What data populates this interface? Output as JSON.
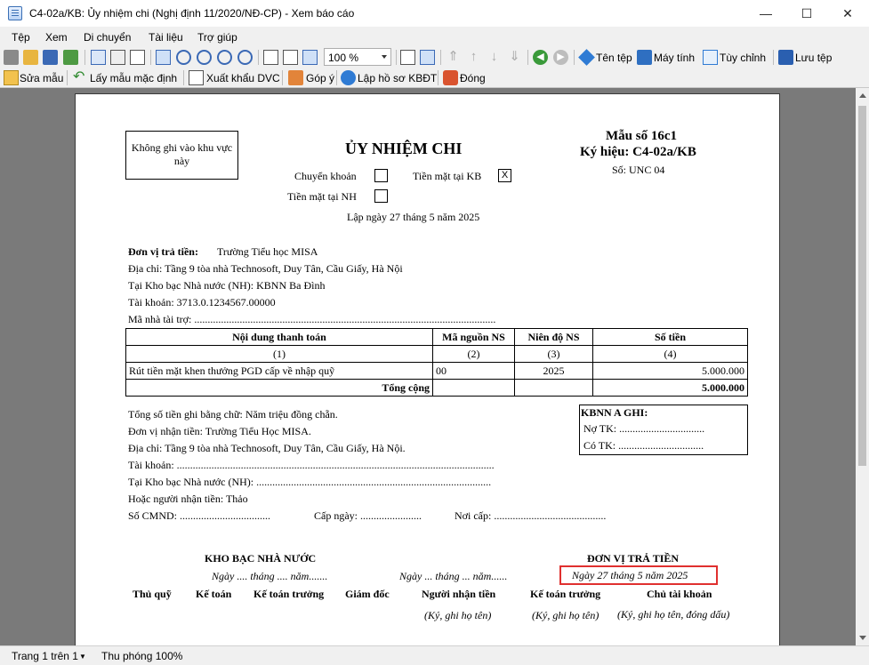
{
  "window": {
    "title": "C4-02a/KB: Ủy nhiệm chi (Nghị định 11/2020/NĐ-CP) - Xem báo cáo",
    "controls": [
      "—",
      "☐",
      "✕"
    ]
  },
  "menu": [
    "Tệp",
    "Xem",
    "Di chuyển",
    "Tài liệu",
    "Trợ giúp"
  ],
  "toolbar": {
    "zoom_value": "100 %",
    "file_name_label": "Tên tệp",
    "calculator_label": "Máy tính",
    "customize_label": "Tùy chỉnh",
    "save_file_label": "Lưu tệp"
  },
  "toolbar2": {
    "edit_template": "Sửa mẫu",
    "default_template": "Lấy mẫu mặc định",
    "export_dvc": "Xuất khẩu DVC",
    "feedback": "Góp ý",
    "create_kbdt": "Lập hồ sơ KBĐT",
    "close": "Đóng"
  },
  "doc": {
    "no_write_box": "Không ghi vào khu vực này",
    "title": "ỦY NHIỆM CHI",
    "form_no": "Mẫu số 16c1",
    "symbol": "Ký hiệu: C4-02a/KB",
    "number": "Số: UNC  04",
    "transfer": "Chuyển khoản",
    "cash_kb": "Tiền mặt tại KB",
    "cash_kb_mark": "X",
    "cash_nh": "Tiền mặt tại NH",
    "date": "Lập ngày 27 tháng 5 năm 2025",
    "payer_label": "Đơn vị trả tiền:",
    "payer_name": "Trường Tiểu học MISA",
    "address": "Địa chỉ: Tầng 9 tòa nhà Technosoft, Duy Tân, Cầu Giấy, Hà Nội",
    "treasury": "Tại Kho bạc Nhà nước (NH): KBNN Ba Đình",
    "account": "Tài khoản: 3713.0.1234567.00000",
    "sponsor": "Mã  nhà  tài  trợ:  .................................................................................................................",
    "table": {
      "headers": [
        "Nội dung thanh toán",
        "Mã nguồn NS",
        "Niên độ NS",
        "Số tiền"
      ],
      "numbers": [
        "(1)",
        "(2)",
        "(3)",
        "(4)"
      ],
      "row": [
        "Rút tiền mặt khen thưởng PGD cấp về nhập quỹ",
        "00",
        "2025",
        "5.000.000"
      ],
      "total_label": "Tổng cộng",
      "total_value": "5.000.000"
    },
    "amount_words": "Tổng số tiền ghi bằng chữ: Năm triệu đồng chẵn.",
    "recipient": "Đơn vị nhận tiền: Trường Tiểu Học MISA.",
    "recipient_address": "Địa chỉ: Tầng 9 tòa nhà Technosoft, Duy Tân, Cầu Giấy, Hà Nội.",
    "recipient_account": "Tài  khoản:  .......................................................................................................................",
    "recipient_treasury": "Tại  Kho  bạc  Nhà  nước  (NH):  ........................................................................................",
    "recipient_person": "Hoặc người nhận tiền: Thảo",
    "id_no": "Số  CMND:  ..................................",
    "issue_date": "Cấp ngày:  .......................",
    "issue_place": "Nơi  cấp:  ..........................................",
    "kbnn_title": "KBNN A GHI:",
    "kbnn_debit": "Nợ TK: ................................",
    "kbnn_credit": "Có TK: ................................",
    "treasury_header": "KHO BẠC NHÀ NƯỚC",
    "payer_header": "ĐƠN VỊ TRẢ TIỀN",
    "date_placeholder_1": "Ngày .... tháng .... năm.......",
    "date_placeholder_2": "Ngày ... tháng ... năm......",
    "sign_date": "Ngày 27 tháng 5 năm 2025",
    "sign_roles": [
      "Thủ quỹ",
      "Kế toán",
      "Kế toán trưởng",
      "Giám đốc",
      "Người nhận tiền",
      "Kế toán trưởng",
      "Chủ tài khoản"
    ],
    "sign_notes": [
      "(Ký, ghi họ tên)",
      "(Ký, ghi họ tên)",
      "(Ký, ghi họ tên, đóng dấu)"
    ]
  },
  "status": {
    "page": "Trang 1 trên 1",
    "zoom": "Thu phóng 100%"
  }
}
